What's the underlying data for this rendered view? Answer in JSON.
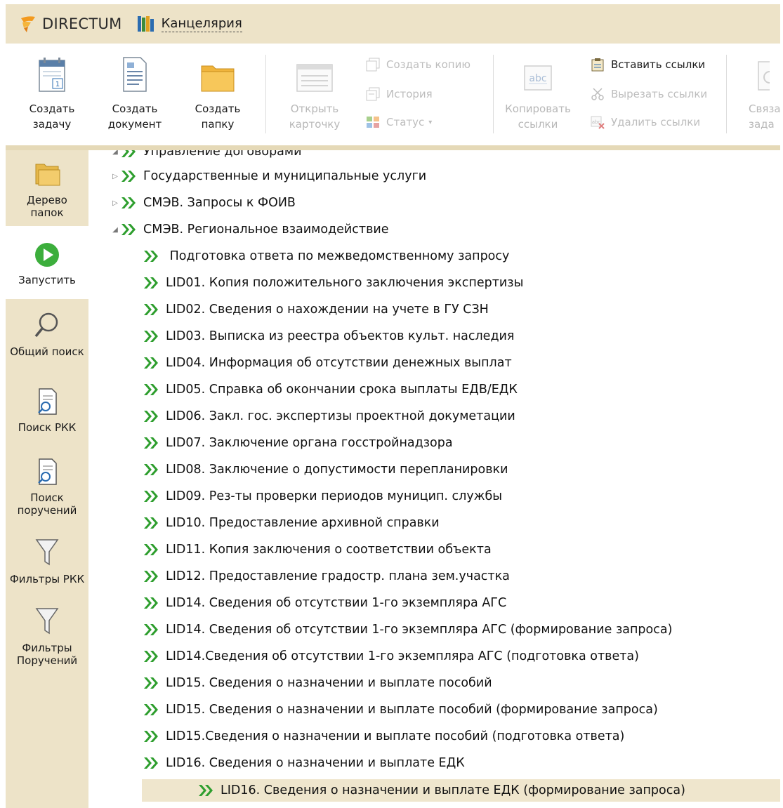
{
  "titlebar": {
    "brand": "DIRECTUM",
    "module": "Канцелярия"
  },
  "ribbon": {
    "create_task": "Создать\nзадачу",
    "create_document": "Создать\nдокумент",
    "create_folder": "Создать\nпапку",
    "open_card": "Открыть\nкарточку",
    "create_copy": "Создать копию",
    "history": "История",
    "status": "Статус",
    "copy_links": "Копировать\nссылки",
    "paste_links": "Вставить ссылки",
    "cut_links": "Вырезать ссылки",
    "delete_links": "Удалить ссылки",
    "related_tasks": "Связан\nзада"
  },
  "leftnav": {
    "items": [
      {
        "label": "Дерево\nпапок"
      },
      {
        "label": "Запустить"
      },
      {
        "label": "Общий поиск"
      },
      {
        "label": "Поиск РКК"
      },
      {
        "label": "Поиск\nпоручений"
      },
      {
        "label": "Фильтры РКК"
      },
      {
        "label": "Фильтры\nПоручений"
      }
    ]
  },
  "tree": {
    "items": [
      {
        "label": "Управление договорами"
      },
      {
        "label": "Государственные и муниципальные услуги"
      },
      {
        "label": "СМЭВ. Запросы к ФОИВ"
      },
      {
        "label": "СМЭВ. Региональное взаимодействие"
      },
      {
        "label": " Подготовка ответа по межведомственному запросу"
      },
      {
        "label": "LID01. Копия положительного заключения экспертизы"
      },
      {
        "label": "LID02. Сведения о нахождении на учете в ГУ СЗН"
      },
      {
        "label": "LID03. Выписка из реестра объектов культ. наследия"
      },
      {
        "label": "LID04. Информация об отсутствии денежных выплат"
      },
      {
        "label": "LID05. Справка об окончании срока выплаты ЕДВ/ЕДК"
      },
      {
        "label": "LID06. Закл. гос. экспертизы проектной докуметации"
      },
      {
        "label": "LID07. Заключение органа госстройнадзора"
      },
      {
        "label": "LID08. Заключение о допустимости перепланировки"
      },
      {
        "label": "LID09. Рез-ты проверки периодов муницип. службы"
      },
      {
        "label": "LID10. Предоставление архивной справки"
      },
      {
        "label": "LID11. Копия заключения о соответствии объекта"
      },
      {
        "label": "LID12. Предоставление градостр. плана зем.участка"
      },
      {
        "label": "LID14. Сведения об отсутствии 1-го экземпляра АГС"
      },
      {
        "label": "LID14. Сведения об отсутствии 1-го экземпляра АГС (формирование запроса)"
      },
      {
        "label": "LID14.Сведения об отсутствии 1-го экземпляра АГС (подготовка ответа)"
      },
      {
        "label": "LID15. Сведения о назначении и выплате пособий"
      },
      {
        "label": "LID15. Сведения о назначении и выплате пособий (формирование запроса)"
      },
      {
        "label": "LID15.Сведения о назначении и выплате пособий (подготовка ответа)"
      },
      {
        "label": "LID16. Сведения о назначении и выплате ЕДК"
      },
      {
        "label": "LID16. Сведения о назначении и выплате ЕДК (формирование запроса)"
      }
    ]
  },
  "colors": {
    "header_bg": "#ede3c8",
    "chevron_green": "#2e9e2e",
    "selection_bg": "#efe6cd"
  }
}
